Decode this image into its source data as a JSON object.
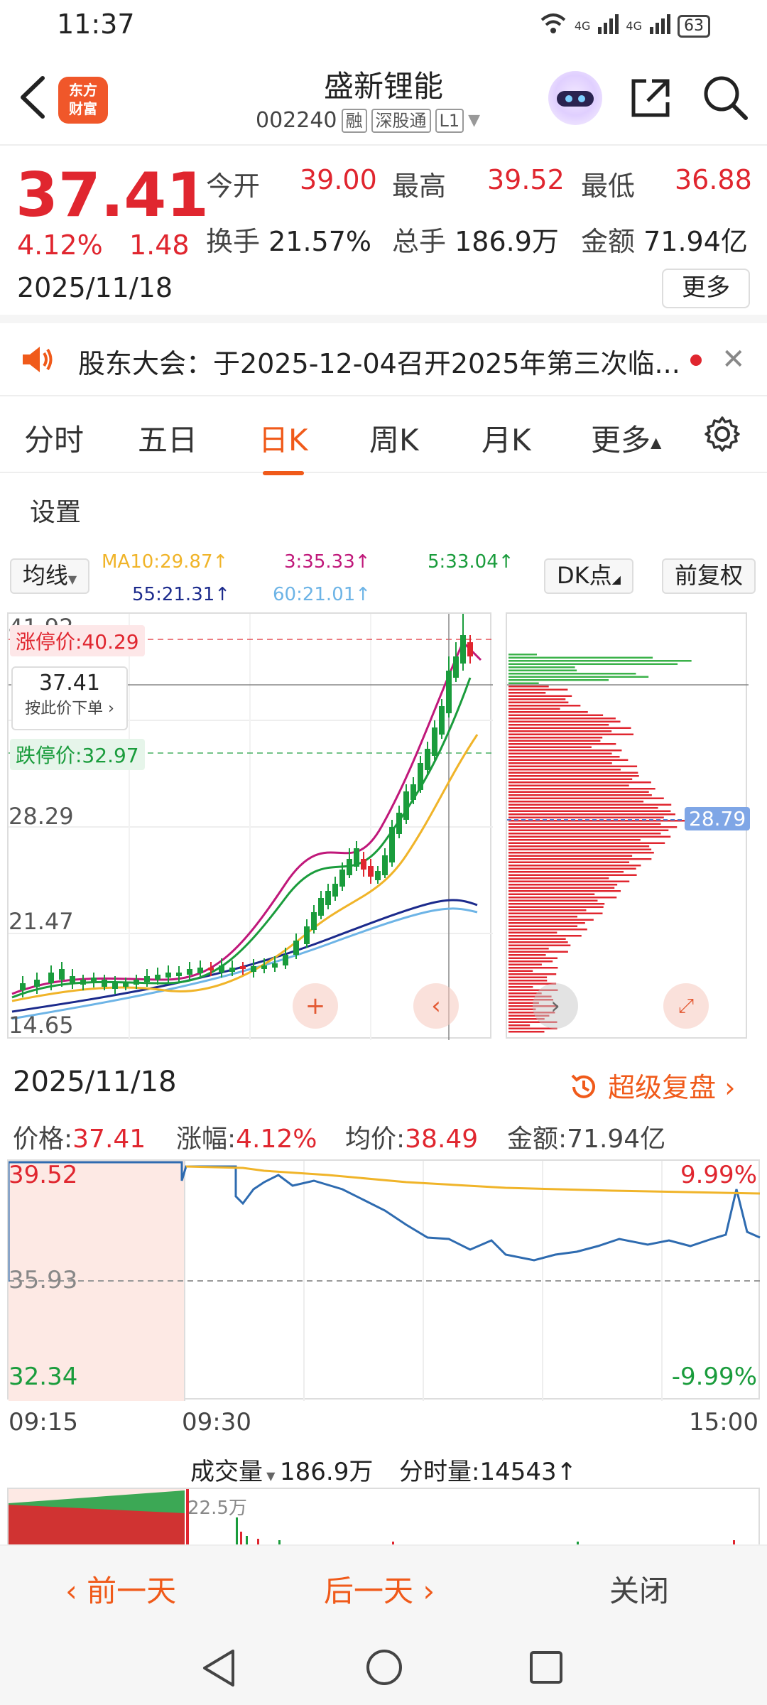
{
  "status": {
    "time": "11:37",
    "signal1": "4G",
    "signal2": "4G",
    "battery": "63"
  },
  "header": {
    "logo_line1": "东方",
    "logo_line2": "财富",
    "title": "盛新锂能",
    "code": "002240",
    "tag_margin": "融",
    "tag_connect": "深股通",
    "tag_level": "L1"
  },
  "quote": {
    "price": "37.41",
    "change_pct": "4.12%",
    "change": "1.48",
    "date": "2025/11/18",
    "open_label": "今开",
    "open": "39.00",
    "high_label": "最高",
    "high": "39.52",
    "low_label": "最低",
    "low": "36.88",
    "turnover_label": "换手",
    "turnover": "21.57%",
    "volume_label": "总手",
    "volume": "186.9万",
    "amount_label": "金额",
    "amount": "71.94亿",
    "more_label": "更多"
  },
  "notice": {
    "text": "股东大会：于2025-12-04召开2025年第三次临..."
  },
  "tabs": [
    {
      "label": "分时"
    },
    {
      "label": "五日"
    },
    {
      "label": "日K"
    },
    {
      "label": "周K"
    },
    {
      "label": "月K"
    },
    {
      "label": "更多"
    }
  ],
  "active_tab": "日K",
  "settings_label": "设置",
  "indicators": {
    "ma_select": "均线",
    "ma10": "MA10:29.87↑",
    "ma3": "3:35.33↑",
    "ma5": "5:33.04↑",
    "ma55": "55:21.31↑",
    "ma60": "60:21.01↑",
    "dk_label": "DK点",
    "adjust_label": "前复权"
  },
  "kchart": {
    "y_top": "41.92",
    "limit_up": "涨停价:40.29",
    "limit_down": "跌停价:32.97",
    "y_mid": "28.29",
    "y_low": "21.47",
    "y_bottom": "14.65",
    "cross_price": "37.41",
    "order_hint": "按此价下单",
    "depth_price": "28.79",
    "colors": {
      "up": "#e0262f",
      "down": "#1a9c3c",
      "ma10": "#f0b429",
      "ma3": "#c0187a",
      "ma5": "#1a9c3c",
      "ma55": "#1b2a8c",
      "ma60": "#6db4e6"
    }
  },
  "detail": {
    "date": "2025/11/18",
    "replay_label": "超级复盘",
    "price_label": "价格:",
    "price": "37.41",
    "chg_label": "涨幅:",
    "chg": "4.12%",
    "avg_label": "均价:",
    "avg": "38.49",
    "amount_label": "金额:",
    "amount": "71.94亿",
    "y_high": "39.52",
    "y_mid": "35.93",
    "y_low": "32.34",
    "pct_high": "9.99%",
    "pct_low": "-9.99%",
    "t_start": "09:15",
    "t_open": "09:30",
    "t_end": "15:00"
  },
  "volume": {
    "select_label": "成交量",
    "total": "186.9万",
    "tick_label": "分时量:",
    "tick": "14543↑",
    "peak": "22.5万"
  },
  "actions": {
    "prev": "前一天",
    "next": "后一天",
    "close": "关闭"
  }
}
